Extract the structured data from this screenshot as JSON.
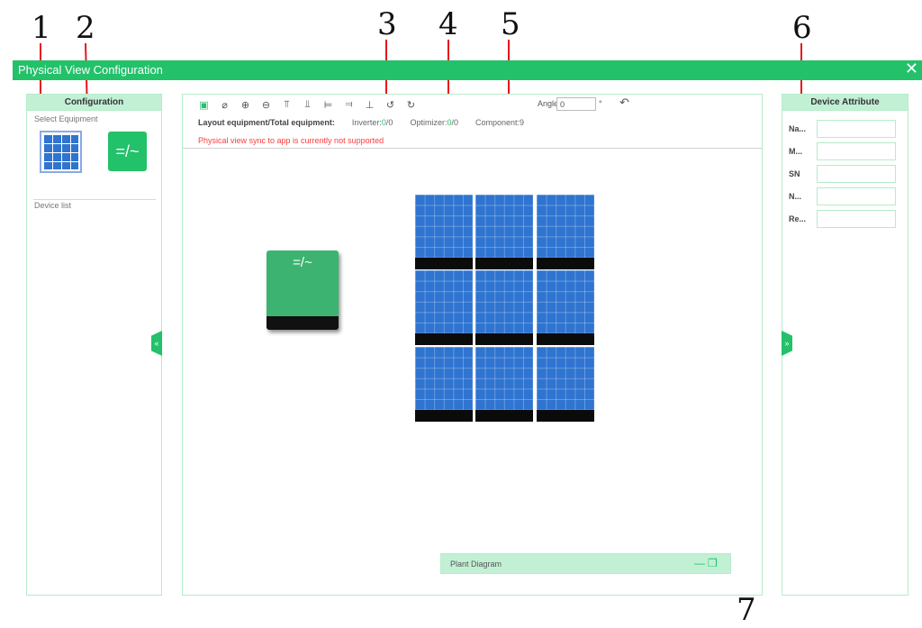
{
  "callouts": [
    "1",
    "2",
    "3",
    "4",
    "5",
    "6",
    "7"
  ],
  "window": {
    "title": "Physical View Configuration",
    "close_icon": "close-icon"
  },
  "left_panel": {
    "title": "Configuration",
    "select_equipment_label": "Select Equipment",
    "device_list_label": "Device list",
    "equipment": [
      {
        "name": "pv-module",
        "icon": "solar-panel-icon"
      },
      {
        "name": "inverter",
        "icon": "inverter-icon",
        "symbol": "=/~"
      }
    ],
    "collapse_glyph": "«"
  },
  "toolbar": {
    "buttons": [
      {
        "name": "save-icon",
        "glyph": "▣"
      },
      {
        "name": "eraser-icon",
        "glyph": "⌀"
      },
      {
        "name": "zoom-in-icon",
        "glyph": "⊕"
      },
      {
        "name": "zoom-out-icon",
        "glyph": "⊖"
      },
      {
        "name": "align-top-icon",
        "glyph": "⫪"
      },
      {
        "name": "align-bottom-icon",
        "glyph": "⫫"
      },
      {
        "name": "align-left-icon",
        "glyph": "⊨"
      },
      {
        "name": "align-right-icon",
        "glyph": "⫤"
      },
      {
        "name": "distribute-icon",
        "glyph": "⊥"
      },
      {
        "name": "rotate-left-icon",
        "glyph": "↺"
      },
      {
        "name": "rotate-right-icon",
        "glyph": "↻"
      }
    ],
    "angle_label": "Angle:",
    "angle_value": "0",
    "angle_unit": "°",
    "undo_glyph": "↶"
  },
  "stats": {
    "layout_label": "Layout equipment/Total equipment:",
    "inverter_label": "Inverter:",
    "inverter_layout": "0",
    "inverter_total": "/0",
    "optimizer_label": "Optimizer:",
    "optimizer_layout": "0",
    "optimizer_total": "/0",
    "component_label": "Component:9"
  },
  "warning": "Physical view sync to app is currently not supported",
  "canvas": {
    "inverter_symbol": "=/~",
    "pv_modules": 9
  },
  "plant_diagram": {
    "label": "Plant Diagram",
    "minimize": "—",
    "restore": "❐"
  },
  "right_panel": {
    "title": "Device Attribute",
    "fields": [
      "Na...",
      "M...",
      "SN",
      "N...",
      "Re..."
    ],
    "expand_glyph": "»"
  },
  "colors": {
    "accent": "#22c16a",
    "panel_header": "#c2f0d5",
    "pv_blue": "#2f74d0",
    "warning": "#ff3b3b"
  }
}
